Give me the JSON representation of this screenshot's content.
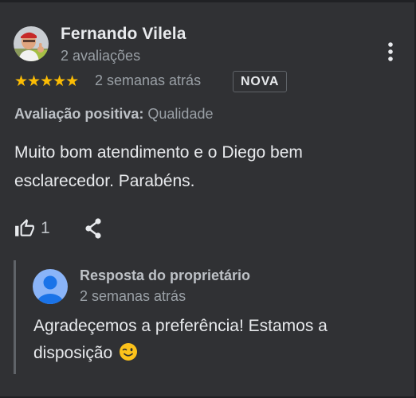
{
  "reviewer": {
    "name": "Fernando Vilela",
    "review_count": "2 avaliações"
  },
  "review": {
    "stars_glyphs": "★★★★★",
    "rating": 5,
    "time": "2 semanas atrás",
    "badge": "NOVA",
    "attribute_label": "Avaliação positiva:",
    "attribute_value": " Qualidade",
    "text": "Muito bom atendimento e o Diego bem esclarecedor. Parabéns.",
    "likes": "1"
  },
  "owner_reply": {
    "title": "Resposta do proprietário",
    "time": "2 semanas atrás",
    "text": "Agradeçemos a preferência! Estamos a disposição "
  },
  "icons": {
    "more": "more-vert-icon",
    "like": "thumb-up-outline-icon",
    "share": "share-icon",
    "emoji": "winking-face-emoji"
  },
  "colors": {
    "background": "#303134",
    "text_primary": "#e8eaed",
    "text_secondary": "#9aa0a6",
    "star": "#fbbc04",
    "owner_avatar": "#8ab4f8"
  }
}
